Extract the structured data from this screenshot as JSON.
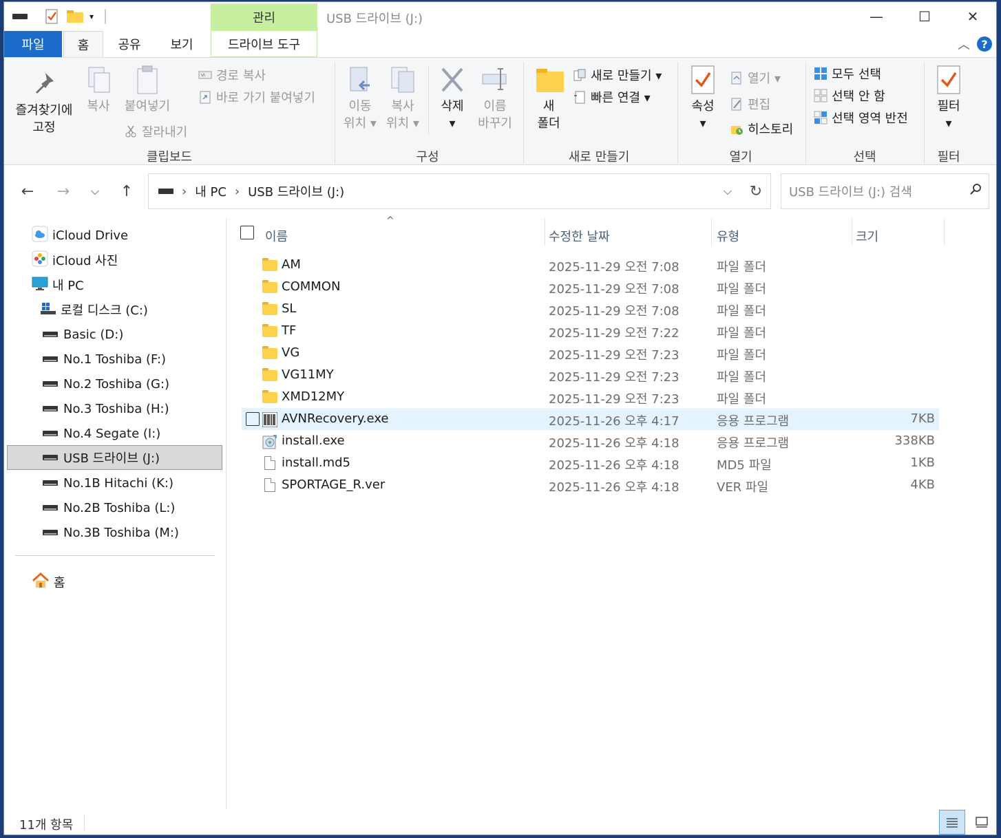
{
  "title_bar": {
    "context_tab_label": "관리",
    "window_title": "USB 드라이브 (J:)",
    "minimize": "—",
    "maximize": "☐",
    "close": "✕"
  },
  "tabs": {
    "file": "파일",
    "home": "홈",
    "share": "공유",
    "view": "보기",
    "drive_tools": "드라이브 도구",
    "help": "?"
  },
  "ribbon": {
    "clipboard": {
      "label": "클립보드",
      "pin": "즐겨찾기에\n고정",
      "copy": "복사",
      "paste": "붙여넣기",
      "copy_path": "경로 복사",
      "paste_shortcut": "바로 가기 붙여넣기",
      "cut": "잘라내기"
    },
    "organize": {
      "label": "구성",
      "move_to": "이동\n위치 ▾",
      "copy_to": "복사\n위치 ▾",
      "delete": "삭제\n▾",
      "rename": "이름\n바꾸기"
    },
    "new": {
      "label": "새로 만들기",
      "new_folder": "새\n폴더",
      "new_item": "새로 만들기 ▾",
      "easy_access": "빠른 연결 ▾"
    },
    "open": {
      "label": "열기",
      "properties": "속성\n▾",
      "open": "열기 ▾",
      "edit": "편집",
      "history": "히스토리"
    },
    "select": {
      "label": "선택",
      "select_all": "모두 선택",
      "select_none": "선택 안 함",
      "invert": "선택 영역 반전"
    },
    "filter": {
      "label": "필터",
      "filter": "필터\n▾"
    }
  },
  "address": {
    "crumb1": "내 PC",
    "crumb2": "USB 드라이브 (J:)",
    "search_placeholder": "USB 드라이브 (J:) 검색"
  },
  "nav": [
    {
      "label": "iCloud Drive"
    },
    {
      "label": "iCloud 사진"
    },
    {
      "label": "내 PC"
    },
    {
      "label": "로컬 디스크 (C:)"
    },
    {
      "label": "Basic (D:)"
    },
    {
      "label": "No.1 Toshiba (F:)"
    },
    {
      "label": "No.2 Toshiba (G:)"
    },
    {
      "label": "No.3 Toshiba (H:)"
    },
    {
      "label": "No.4 Segate (I:)"
    },
    {
      "label": "USB 드라이브 (J:)"
    },
    {
      "label": "No.1B Hitachi (K:)"
    },
    {
      "label": "No.2B Toshiba (L:)"
    },
    {
      "label": "No.3B Toshiba (M:)"
    },
    {
      "label": "홈"
    }
  ],
  "columns": {
    "name": "이름",
    "date": "수정한 날짜",
    "type": "유형",
    "size": "크기"
  },
  "files": [
    {
      "name": "AM",
      "date": "2025-11-29 오전 7:08",
      "type": "파일 폴더",
      "size": "",
      "icon": "folder"
    },
    {
      "name": "COMMON",
      "date": "2025-11-29 오전 7:08",
      "type": "파일 폴더",
      "size": "",
      "icon": "folder"
    },
    {
      "name": "SL",
      "date": "2025-11-29 오전 7:08",
      "type": "파일 폴더",
      "size": "",
      "icon": "folder"
    },
    {
      "name": "TF",
      "date": "2025-11-29 오전 7:22",
      "type": "파일 폴더",
      "size": "",
      "icon": "folder"
    },
    {
      "name": "VG",
      "date": "2025-11-29 오전 7:23",
      "type": "파일 폴더",
      "size": "",
      "icon": "folder"
    },
    {
      "name": "VG11MY",
      "date": "2025-11-29 오전 7:23",
      "type": "파일 폴더",
      "size": "",
      "icon": "folder"
    },
    {
      "name": "XMD12MY",
      "date": "2025-11-29 오전 7:23",
      "type": "파일 폴더",
      "size": "",
      "icon": "folder"
    },
    {
      "name": "AVNRecovery.exe",
      "date": "2025-11-26 오후 4:17",
      "type": "응용 프로그램",
      "size": "7KB",
      "icon": "exe-barcode"
    },
    {
      "name": "install.exe",
      "date": "2025-11-26 오후 4:18",
      "type": "응용 프로그램",
      "size": "338KB",
      "icon": "installer"
    },
    {
      "name": "install.md5",
      "date": "2025-11-26 오후 4:18",
      "type": "MD5 파일",
      "size": "1KB",
      "icon": "document"
    },
    {
      "name": "SPORTAGE_R.ver",
      "date": "2025-11-26 오후 4:18",
      "type": "VER 파일",
      "size": "4KB",
      "icon": "document"
    }
  ],
  "status": {
    "count": "11개 항목"
  },
  "colors": {
    "file_tab": "#1a6cc8",
    "context_tab": "#c6efa0",
    "folder": "#ffd24d",
    "selection": "#d9d9d9",
    "hover_row": "#e5f3ff"
  }
}
